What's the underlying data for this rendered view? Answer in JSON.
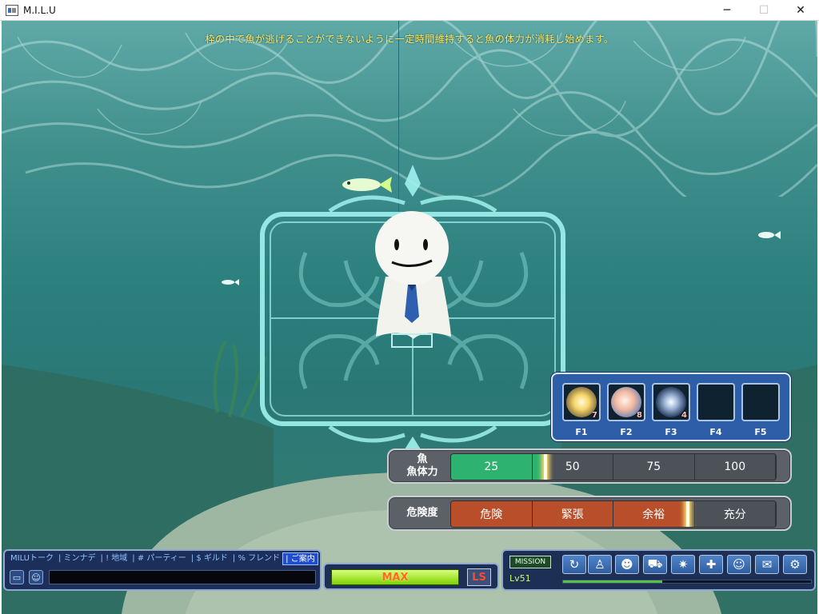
{
  "window": {
    "title": "M.I.L.U",
    "controls": {
      "minimize": "─",
      "maximize": "☐",
      "close": "✕"
    }
  },
  "game": {
    "hint": "枠の中で魚が逃げることができないように一定時間維持すると魚の体力が消耗し始めます。"
  },
  "skills": {
    "slots": [
      {
        "key": "F1",
        "count": "7",
        "icon": "sparkle-orb-icon"
      },
      {
        "key": "F2",
        "count": "8",
        "icon": "glow-orb-icon"
      },
      {
        "key": "F3",
        "count": "4",
        "icon": "lightning-orb-icon"
      },
      {
        "key": "F4",
        "count": "",
        "icon": ""
      },
      {
        "key": "F5",
        "count": "",
        "icon": ""
      }
    ]
  },
  "fish_hp": {
    "label_line1": "魚",
    "label_line2": "魚体力",
    "segments": [
      "25",
      "50",
      "75",
      "100"
    ],
    "level_percent": 29,
    "fill_color": "#2db36f"
  },
  "danger": {
    "label": "危険度",
    "segments": [
      "危険",
      "緊張",
      "余裕",
      "充分"
    ],
    "level_percent": 73,
    "fill_color": "#b94f2a"
  },
  "chat": {
    "tabs": [
      "MILUトーク",
      "ミンナデ",
      "! 地域",
      "# パーティー",
      "$ ギルド",
      "% フレンド",
      "ご案内"
    ],
    "active_tab": 6,
    "input_value": ""
  },
  "status": {
    "max_label": "MAX",
    "ls_label": "LS"
  },
  "menu": {
    "mission_label": "MISSION",
    "level": "Lv51",
    "buttons": [
      "return-arrow-icon",
      "character-icon",
      "avatar-icon",
      "vehicle-icon",
      "effect-burst-icon",
      "add-friend-icon",
      "party-icon",
      "chat-bubble-icon",
      "settings-gear-icon"
    ],
    "xp_percent": 40
  }
}
